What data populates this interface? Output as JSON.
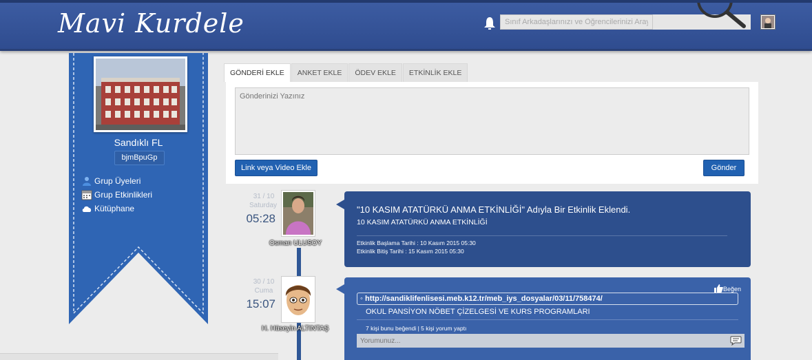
{
  "header": {
    "logo": "Mavi Kurdele",
    "search_placeholder": "Sınıf Arkadaşlarınızı ve Öğrencilerinizi Arayın..."
  },
  "sidebar": {
    "group_name": "Sandıklı FL",
    "group_code": "bjmBpuGp",
    "items": [
      {
        "label": "Grup Üyeleri",
        "icon": "people-icon"
      },
      {
        "label": "Grup Etkinlikleri",
        "icon": "calendar-icon"
      },
      {
        "label": "Kütüphane",
        "icon": "cloud-icon"
      }
    ]
  },
  "composer": {
    "tabs": [
      {
        "label": "GÖNDERİ EKLE",
        "active": true
      },
      {
        "label": "ANKET EKLE",
        "active": false
      },
      {
        "label": "ÖDEV EKLE",
        "active": false
      },
      {
        "label": "ETKİNLİK EKLE",
        "active": false
      }
    ],
    "placeholder": "Gönderinizi Yazınız",
    "link_button": "Link veya Video Ekle",
    "send_button": "Gönder"
  },
  "posts": [
    {
      "date": "31 / 10",
      "day": "Saturday",
      "time": "05:28",
      "user": "Osman ULUSOY",
      "title": "\"10 KASIM ATATÜRKÜ ANMA ETKİNLİĞİ\" Adıyla Bir Etkinlik Eklendi.",
      "subtitle": "10 KASIM ATATÜRKÜ ANMA ETKİNLİĞİ",
      "start": "Etkinlik Başlama Tarihi : 10 Kasım 2015 05:30",
      "end": "Etkinlik Bitiş Tarihi : 15 Kasım 2015 05:30"
    },
    {
      "date": "30 / 10",
      "day": "Cuma",
      "time": "15:07",
      "user": "H. Hüseyin ALTINTAŞ",
      "like_label": "Beğen",
      "link": "http://sandiklifenlisesi.meb.k12.tr/meb_iys_dosyalar/03/11/758474/",
      "link_title": "OKUL PANSİYON NÖBET ÇİZELGESİ VE KURS PROGRAMLARI",
      "stats": "7 kişi bunu beğendi | 5 kişi yorum yaptı",
      "comment_placeholder": "Yorumunuz..."
    }
  ]
}
